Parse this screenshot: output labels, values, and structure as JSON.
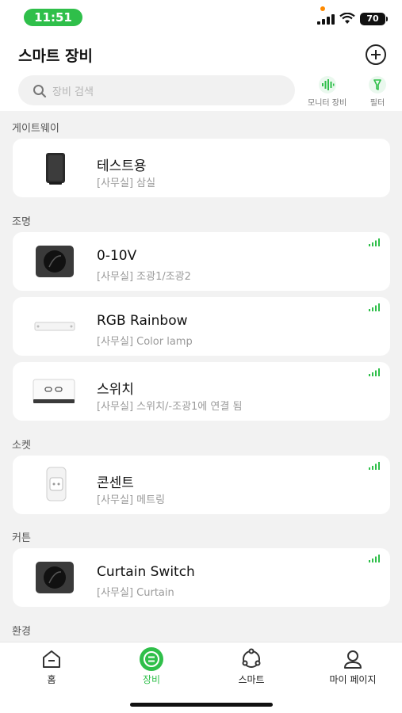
{
  "status_bar": {
    "time": "11:51",
    "battery": "70"
  },
  "header": {
    "title": "스마트 장비",
    "search_placeholder": "장비 검색",
    "monitor_label": "모니터 장비",
    "filter_label": "필터"
  },
  "sections": [
    {
      "title": "게이트웨이",
      "devices": [
        {
          "name": "테스트용",
          "sub": "[사무실] 삼실"
        }
      ]
    },
    {
      "title": "조명",
      "devices": [
        {
          "name": "0-10V",
          "sub": "[사무실] 조광1/조광2"
        },
        {
          "name": "RGB Rainbow",
          "sub": "[사무실] Color lamp"
        },
        {
          "name": "스위치",
          "sub": "[사무실] 스위치/-조광1에 연결 됨"
        }
      ]
    },
    {
      "title": "소켓",
      "devices": [
        {
          "name": "콘센트",
          "sub": "[사무실] 메트링"
        }
      ]
    },
    {
      "title": "커튼",
      "devices": [
        {
          "name": "Curtain Switch",
          "sub": "[사무실] Curtain"
        }
      ]
    },
    {
      "title": "환경",
      "devices": []
    }
  ],
  "bottom_nav": [
    {
      "label": "홈",
      "icon": "home-icon",
      "active": false
    },
    {
      "label": "장비",
      "icon": "device-icon",
      "active": true
    },
    {
      "label": "스마트",
      "icon": "smart-icon",
      "active": false
    },
    {
      "label": "마이 페이지",
      "icon": "profile-icon",
      "active": false
    }
  ],
  "colors": {
    "accent": "#2fbf4a",
    "background": "#f2f2f2",
    "card": "#ffffff"
  }
}
